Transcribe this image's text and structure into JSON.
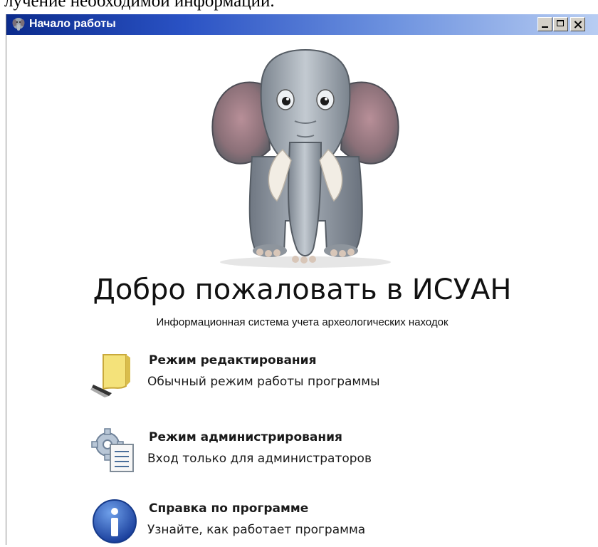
{
  "background_caption": "лучение необходимой информации.",
  "window": {
    "title": "Начало работы",
    "title_bar_color": "#0b2b8c"
  },
  "welcome": {
    "title": "Добро пожаловать в ИСУАН",
    "subtitle": "Информационная система учета археологических находок"
  },
  "menu": [
    {
      "icon": "notepad-pencil-icon",
      "label": "Режим редактирования",
      "description": "Обычный режим работы программы"
    },
    {
      "icon": "gear-document-icon",
      "label": "Режим администрирования",
      "description": "Вход только для администраторов"
    },
    {
      "icon": "info-icon",
      "label": "Справка по программе",
      "description": "Узнайте, как работает программа"
    }
  ]
}
